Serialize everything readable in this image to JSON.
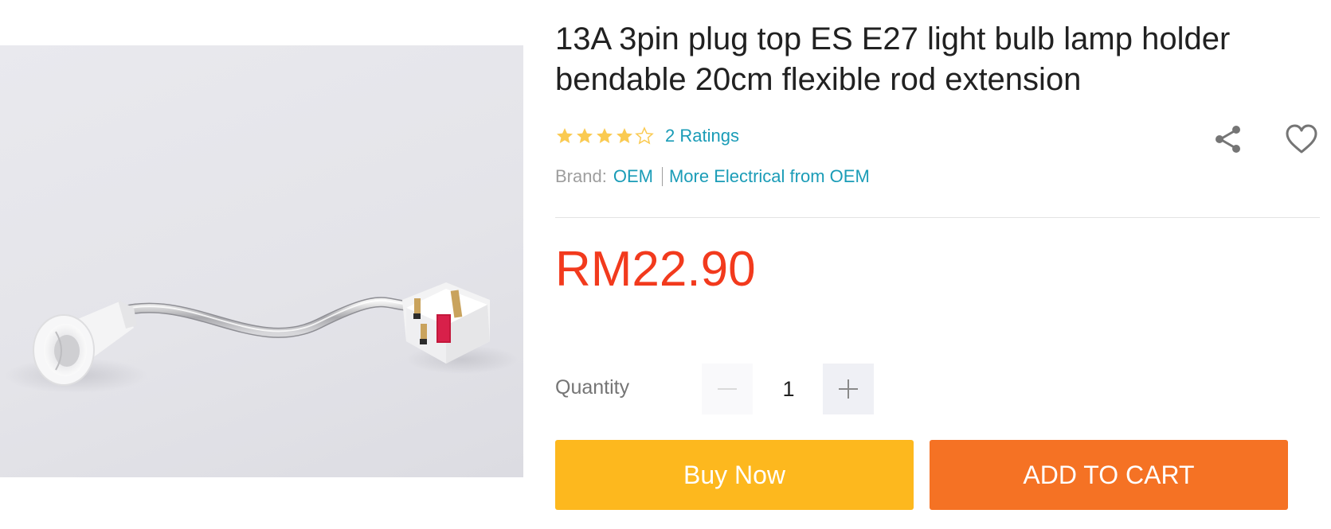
{
  "product": {
    "title": "13A 3pin plug top ES E27 light bulb lamp holder bendable 20cm flexible rod extension",
    "image_alt": "E27 lamp holder with flexible rod and UK plug"
  },
  "rating": {
    "stars": 4,
    "max_stars": 5,
    "count_label": "2 Ratings",
    "star_color": "#faca51"
  },
  "brand": {
    "label": "Brand:",
    "name": "OEM",
    "more_label": "More Electrical from OEM"
  },
  "price": {
    "text": "RM22.90",
    "color": "#f23a1d"
  },
  "quantity": {
    "label": "Quantity",
    "value": "1"
  },
  "actions": {
    "buy_now_label": "Buy Now",
    "add_to_cart_label": "ADD TO CART",
    "buy_color": "#fdb81e",
    "cart_color": "#f57224"
  },
  "icons": {
    "share": "share-icon",
    "wishlist": "heart-icon",
    "minus": "minus-icon",
    "plus": "plus-icon"
  },
  "colors": {
    "link": "#1a9cb7",
    "muted": "#9e9e9e"
  }
}
